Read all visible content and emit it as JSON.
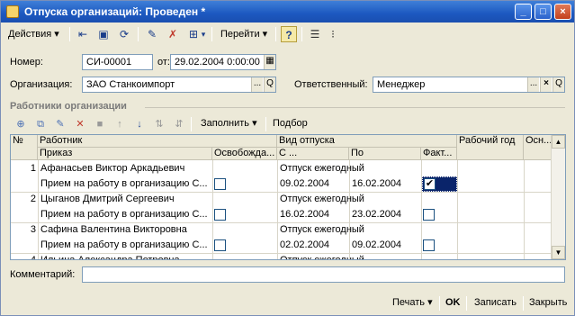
{
  "window": {
    "title": "Отпуска организаций: Проведен *",
    "minimize": "_",
    "maximize": "□",
    "close": "×"
  },
  "toolbar": {
    "actions_label": "Действия",
    "goto_label": "Перейти",
    "help_label": "?"
  },
  "form": {
    "number_label": "Номер:",
    "number_value": "СИ-00001",
    "date_label": "от:",
    "date_value": "29.02.2004  0:00:00",
    "org_label": "Организация:",
    "org_value": "ЗАО Станкоимпорт",
    "resp_label": "Ответственный:",
    "resp_value": "Менеджер",
    "select_btn": "...",
    "clear_btn": "×",
    "open_btn": "Q"
  },
  "section": {
    "title": "Работники организации",
    "fill_label": "Заполнить",
    "pick_label": "Подбор"
  },
  "grid": {
    "headers": {
      "num": "№",
      "worker": "Работник",
      "order": "Приказ",
      "release": "Освобожда...",
      "vac_type": "Вид отпуска",
      "from": "С ...",
      "to": "По",
      "fact": "Факт...",
      "work_year": "Рабочий год",
      "osn": "Осн..."
    },
    "rows": [
      {
        "num": "1",
        "worker": "Афанасьев Виктор Аркадьевич",
        "order": "Прием на работу в организацию С...",
        "vac_type": "Отпуск ежегодный",
        "from": "09.02.2004",
        "to": "16.02.2004",
        "release": false,
        "fact": true
      },
      {
        "num": "2",
        "worker": "Цыганов Дмитрий Сергеевич",
        "order": "Прием на работу в организацию С...",
        "vac_type": "Отпуск ежегодный",
        "from": "16.02.2004",
        "to": "23.02.2004",
        "release": false,
        "fact": false
      },
      {
        "num": "3",
        "worker": "Сафина Валентина Викторовна",
        "order": "Прием на работу в организацию С...",
        "vac_type": "Отпуск ежегодный",
        "from": "02.02.2004",
        "to": "09.02.2004",
        "release": false,
        "fact": false
      },
      {
        "num": "4",
        "worker": "Ильина Александра Петровна",
        "vac_type": "Отпуск ежегодный"
      }
    ]
  },
  "comment": {
    "label": "Комментарий:",
    "value": ""
  },
  "bottom": {
    "print_label": "Печать",
    "ok_label": "OK",
    "save_label": "Записать",
    "close_label": "Закрыть"
  },
  "colors": {
    "titlebar": "#1c58c0",
    "face": "#ece9d8",
    "selection": "#0a246a"
  }
}
